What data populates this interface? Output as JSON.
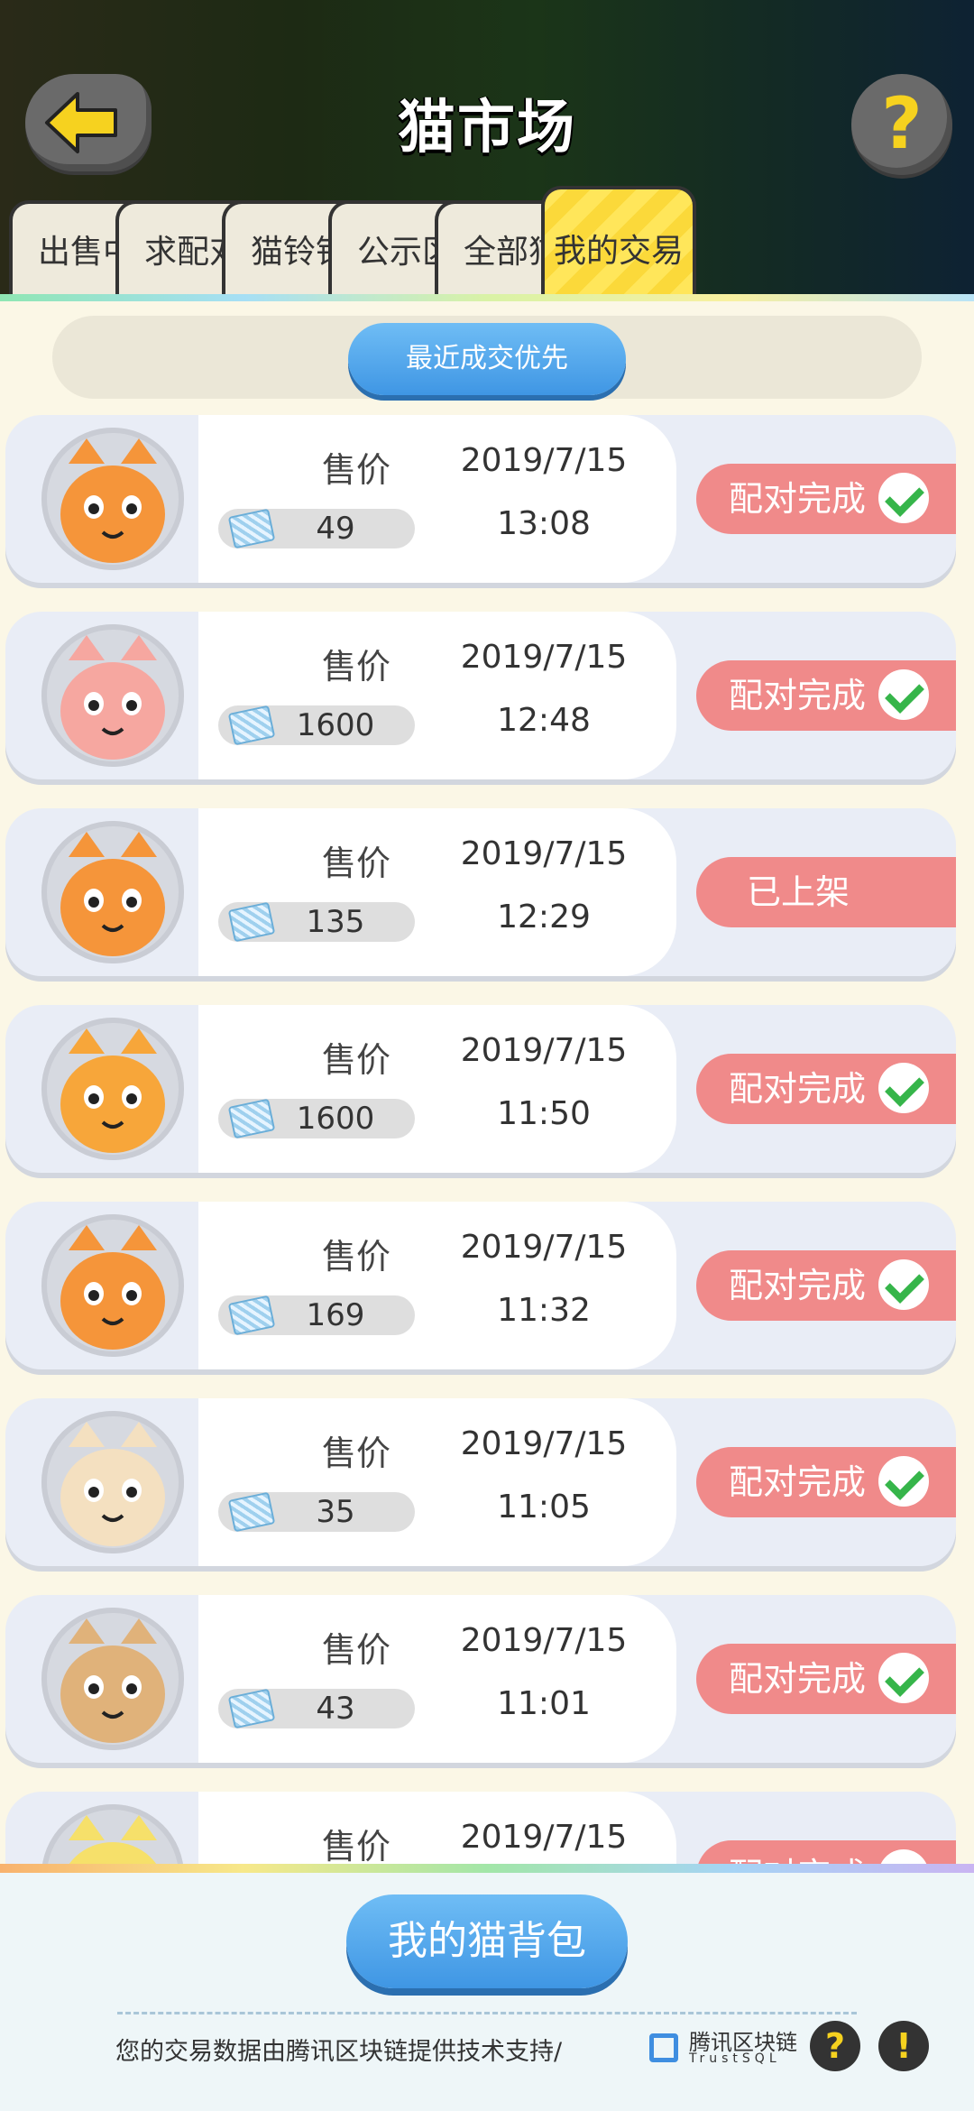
{
  "header": {
    "title": "猫市场",
    "help_label": "?"
  },
  "tabs": [
    {
      "label": "出售中"
    },
    {
      "label": "求配对"
    },
    {
      "label": "猫铃铛"
    },
    {
      "label": "公示区"
    },
    {
      "label": "全部猫"
    },
    {
      "label": "我的交易",
      "active": true
    }
  ],
  "sort_button": "最近成交优先",
  "price_label": "售价",
  "status_complete": "配对完成",
  "status_listed": "已上架",
  "rows": [
    {
      "price": "49",
      "date": "2019/7/15",
      "time": "13:08",
      "status": "配对完成",
      "done": true,
      "cat_color": "#f5953a"
    },
    {
      "price": "1600",
      "date": "2019/7/15",
      "time": "12:48",
      "status": "配对完成",
      "done": true,
      "cat_color": "#f6a7a0"
    },
    {
      "price": "135",
      "date": "2019/7/15",
      "time": "12:29",
      "status": "已上架",
      "done": false,
      "cat_color": "#f5953a"
    },
    {
      "price": "1600",
      "date": "2019/7/15",
      "time": "11:50",
      "status": "配对完成",
      "done": true,
      "cat_color": "#f7a63a"
    },
    {
      "price": "169",
      "date": "2019/7/15",
      "time": "11:32",
      "status": "配对完成",
      "done": true,
      "cat_color": "#f5953a"
    },
    {
      "price": "35",
      "date": "2019/7/15",
      "time": "11:05",
      "status": "配对完成",
      "done": true,
      "cat_color": "#f4e0c0"
    },
    {
      "price": "43",
      "date": "2019/7/15",
      "time": "11:01",
      "status": "配对完成",
      "done": true,
      "cat_color": "#e0b27a"
    },
    {
      "price": "",
      "date": "2019/7/15",
      "time": "",
      "status": "配对完成",
      "done": true,
      "cat_color": "#f6e06a"
    }
  ],
  "bottom": {
    "bag_button": "我的猫背包",
    "footer_text": "您的交易数据由腾讯区块链提供技术支持/",
    "chain_name": "腾讯区块链",
    "chain_sub": "TrustSQL",
    "help_icon": "?",
    "info_icon": "!"
  },
  "colors": {
    "accent_blue": "#3f96e4",
    "status_red": "#f08a8a",
    "check_green": "#36b54a",
    "tab_active_yellow": "#ffe65a"
  }
}
